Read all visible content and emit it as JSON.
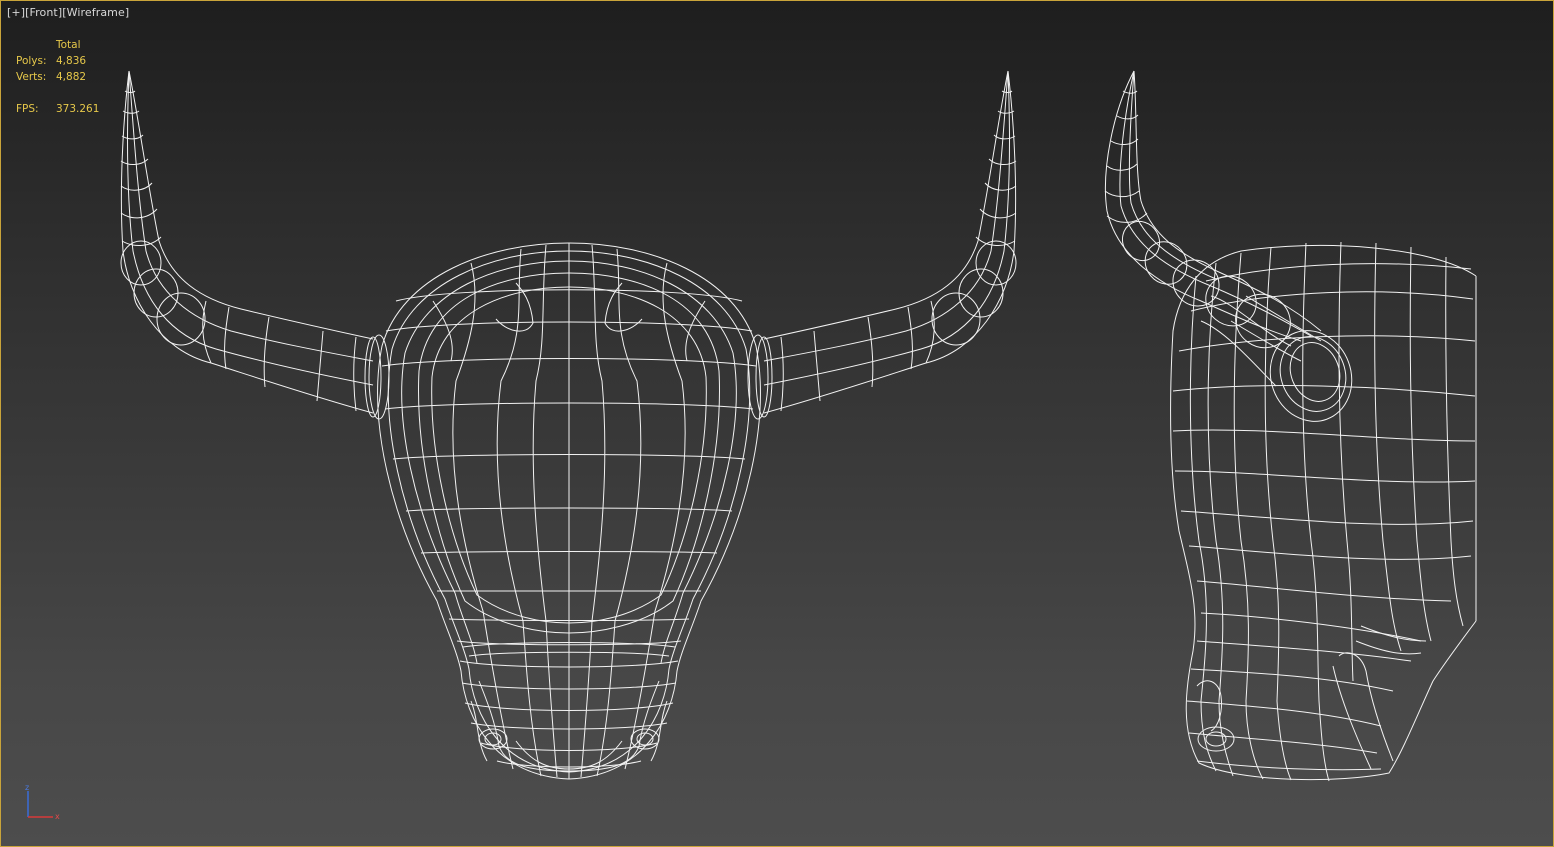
{
  "viewport": {
    "label_plus": "[+]",
    "label_view": "[Front]",
    "label_mode": "[Wireframe]"
  },
  "stats": {
    "header": "Total",
    "polys_label": "Polys:",
    "polys_value": "4,836",
    "verts_label": "Verts:",
    "verts_value": "4,882",
    "fps_label": "FPS:",
    "fps_value": "373.261"
  },
  "gizmo": {
    "z_label": "z",
    "x_label": "x",
    "z_color": "#3a6cd8",
    "x_color": "#d83a3a"
  },
  "colors": {
    "frame_border": "#c9a43a",
    "stats_text": "#e6c84a",
    "wire": "#f2f2f2"
  }
}
